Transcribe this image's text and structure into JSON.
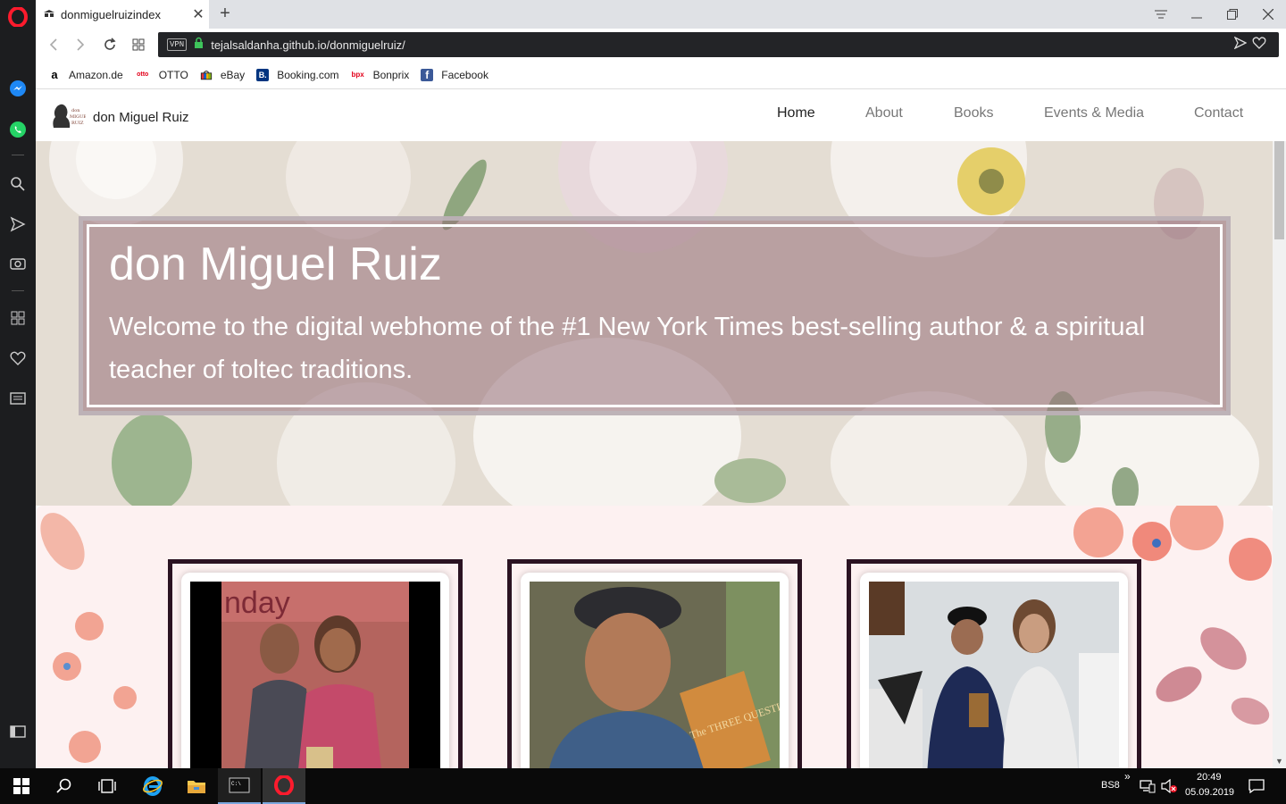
{
  "browser": {
    "tab_title": "donmiguelruizindex",
    "url": "tejalsaldanha.github.io/donmiguelruiz/",
    "vpn_label": "VPN",
    "bookmarks": [
      {
        "label": "Amazon.de",
        "icon": "amazon-icon"
      },
      {
        "label": "OTTO",
        "icon": "otto-icon"
      },
      {
        "label": "eBay",
        "icon": "ebay-icon"
      },
      {
        "label": "Booking.com",
        "icon": "booking-icon"
      },
      {
        "label": "Bonprix",
        "icon": "bonprix-icon"
      },
      {
        "label": "Facebook",
        "icon": "facebook-icon"
      }
    ]
  },
  "site": {
    "brand": "don Miguel Ruiz",
    "logo_text": "don MIGUEL RUIZ",
    "nav": [
      {
        "label": "Home",
        "active": true
      },
      {
        "label": "About",
        "active": false
      },
      {
        "label": "Books",
        "active": false
      },
      {
        "label": "Events & Media",
        "active": false
      },
      {
        "label": "Contact",
        "active": false
      }
    ],
    "hero": {
      "title": "don Miguel Ruiz",
      "subtitle": "Welcome to the digital webhome of the #1 New York Times best-selling author & a spiritual teacher of toltec traditions."
    },
    "cards": [
      {
        "photo": "don Miguel Ruiz with Oprah Winfrey",
        "sign_text": "nday"
      },
      {
        "photo": "don Miguel Ruiz holding The Three Questions",
        "book_text": "The THREE QUESTIONS"
      },
      {
        "photo": "don Miguel Ruiz with a woman holding a book"
      }
    ]
  },
  "taskbar": {
    "lang": "BS8",
    "time": "20:49",
    "date": "05.09.2019"
  },
  "colors": {
    "opera_red": "#ff1b2d",
    "dark_frame": "#2b1322",
    "hero_bg": "#e4ddd3",
    "content_bg": "#fdf1f1"
  }
}
